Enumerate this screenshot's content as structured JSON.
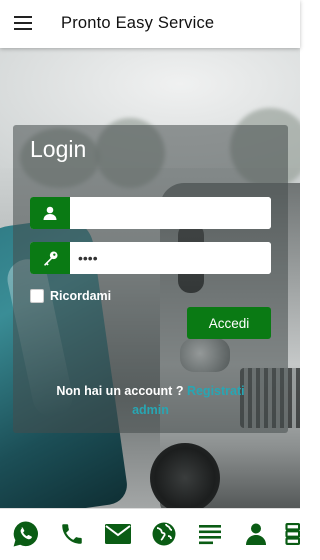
{
  "appbar": {
    "title": "Pronto Easy Service",
    "menu_icon": "hamburger-menu-icon"
  },
  "login": {
    "title": "Login",
    "username": {
      "value": "",
      "placeholder": "",
      "icon": "user-icon"
    },
    "password": {
      "value": "••••",
      "placeholder": "",
      "icon": "key-icon"
    },
    "remember_label": "Ricordami",
    "submit_label": "Accedi",
    "no_account_text": "Non hai un account ?",
    "register_link": "Registrati",
    "admin_link": "admin"
  },
  "bottom_nav": [
    {
      "icon": "whatsapp-icon"
    },
    {
      "icon": "phone-icon"
    },
    {
      "icon": "mail-icon"
    },
    {
      "icon": "globe-icon"
    },
    {
      "icon": "list-icon"
    },
    {
      "icon": "person-icon"
    },
    {
      "icon": "more-icon"
    }
  ],
  "colors": {
    "accent": "#0a7a14",
    "link": "#28a6b3",
    "card_bg": "rgba(70,76,76,0.55)"
  }
}
